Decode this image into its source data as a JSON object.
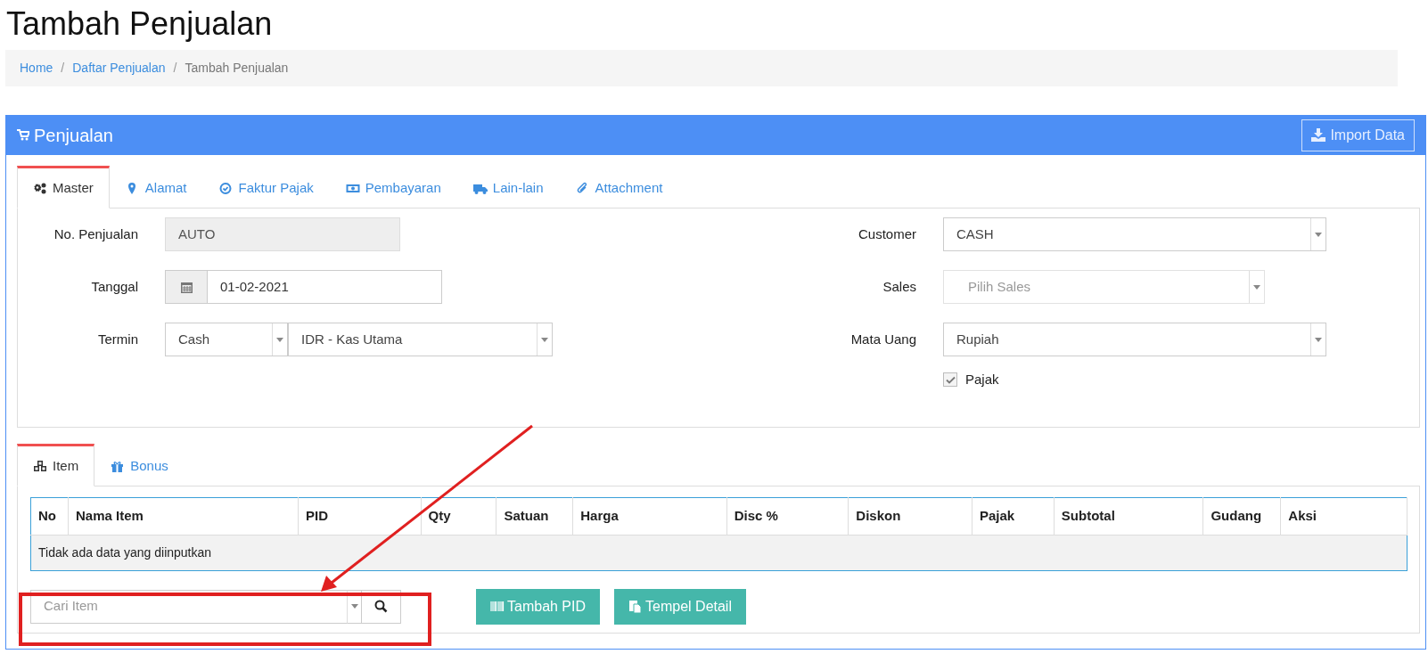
{
  "page_title": "Tambah Penjualan",
  "breadcrumb": [
    {
      "label": "Home",
      "current": false
    },
    {
      "separator": "/",
      "label": "Daftar Penjualan",
      "current": false
    },
    {
      "separator": "/",
      "label": "Tambah Penjualan",
      "current": true
    }
  ],
  "panel": {
    "title": "Penjualan",
    "import_button": "Import Data"
  },
  "tabs": [
    {
      "label": "Master",
      "selected": true
    },
    {
      "label": "Alamat",
      "selected": false
    },
    {
      "label": "Faktur Pajak",
      "selected": false
    },
    {
      "label": "Pembayaran",
      "selected": false
    },
    {
      "label": "Lain-lain",
      "selected": false
    },
    {
      "label": "Attachment",
      "selected": false
    }
  ],
  "left_fields": [
    {
      "label": "No. Penjualan",
      "kind": "readonly",
      "value": "AUTO"
    },
    {
      "label": "Tanggal",
      "kind": "date",
      "value": "01-02-2021"
    },
    {
      "label": "Termin",
      "kind": "double_select",
      "value": "Cash",
      "value_2": "IDR - Kas Utama"
    }
  ],
  "right_fields": [
    {
      "label": "Customer",
      "kind": "select",
      "value": "CASH"
    },
    {
      "label": "Sales",
      "kind": "select",
      "placeholder": "Pilih Sales"
    },
    {
      "label": "Mata Uang",
      "kind": "select",
      "value": "Rupiah"
    }
  ],
  "pajak": {
    "label": "Pajak",
    "checked": true
  },
  "item_tabs": [
    {
      "label": "Item",
      "selected": true
    },
    {
      "label": "Bonus",
      "selected": false
    }
  ],
  "table": {
    "columns": [
      "No",
      "Nama Item",
      "PID",
      "Qty",
      "Satuan",
      "Harga",
      "Disc %",
      "Diskon",
      "Pajak",
      "Subtotal",
      "Gudang",
      "Aksi"
    ],
    "empty_message": "Tidak ada data yang diinputkan"
  },
  "search": {
    "placeholder": "Cari Item"
  },
  "buttons": [
    {
      "label": "Tambah PID"
    },
    {
      "label": "Tempel Detail"
    }
  ]
}
